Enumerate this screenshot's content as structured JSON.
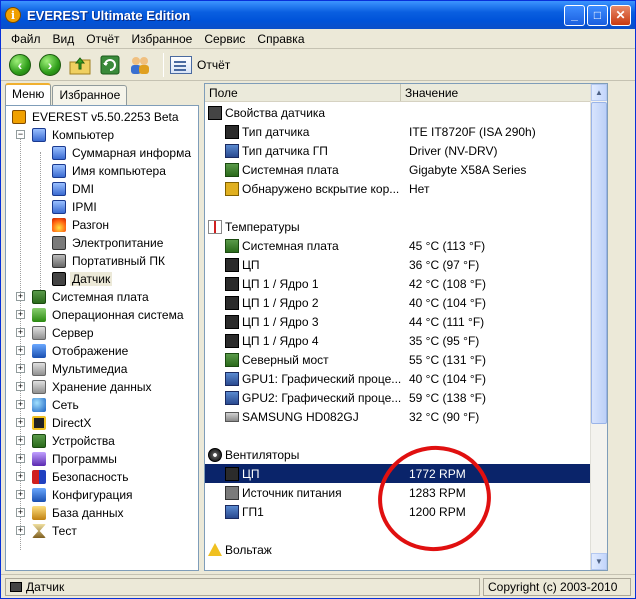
{
  "window": {
    "title": "EVEREST Ultimate Edition"
  },
  "menu": [
    "Файл",
    "Вид",
    "Отчёт",
    "Избранное",
    "Сервис",
    "Справка"
  ],
  "toolbar": {
    "report_label": "Отчёт"
  },
  "tabs": {
    "menu": "Меню",
    "favorites": "Избранное"
  },
  "tree": {
    "root": "EVEREST v5.50.2253 Beta",
    "computer": "Компьютер",
    "computer_children": [
      "Суммарная информа",
      "Имя компьютера",
      "DMI",
      "IPMI",
      "Разгон",
      "Электропитание",
      "Портативный ПК",
      "Датчик"
    ],
    "sections": [
      "Системная плата",
      "Операционная система",
      "Сервер",
      "Отображение",
      "Мультимедиа",
      "Хранение данных",
      "Сеть",
      "DirectX",
      "Устройства",
      "Программы",
      "Безопасность",
      "Конфигурация",
      "База данных",
      "Тест"
    ]
  },
  "columns": {
    "field": "Поле",
    "value": "Значение"
  },
  "groups": {
    "sensor_props": {
      "title": "Свойства датчика",
      "rows": [
        {
          "field": "Тип датчика",
          "value": "ITE IT8720F  (ISA 290h)"
        },
        {
          "field": "Тип датчика ГП",
          "value": "Driver  (NV-DRV)"
        },
        {
          "field": "Системная плата",
          "value": "Gigabyte X58A Series"
        },
        {
          "field": "Обнаружено вскрытие кор...",
          "value": "Нет"
        }
      ]
    },
    "temperatures": {
      "title": "Температуры",
      "rows": [
        {
          "field": "Системная плата",
          "value": "45 °C  (113 °F)"
        },
        {
          "field": "ЦП",
          "value": "36 °C  (97 °F)"
        },
        {
          "field": "ЦП 1 / Ядро 1",
          "value": "42 °C  (108 °F)"
        },
        {
          "field": "ЦП 1 / Ядро 2",
          "value": "40 °C  (104 °F)"
        },
        {
          "field": "ЦП 1 / Ядро 3",
          "value": "44 °C  (111 °F)"
        },
        {
          "field": "ЦП 1 / Ядро 4",
          "value": "35 °C  (95 °F)"
        },
        {
          "field": "Северный мост",
          "value": "55 °C  (131 °F)"
        },
        {
          "field": "GPU1: Графический проце...",
          "value": "40 °C  (104 °F)"
        },
        {
          "field": "GPU2: Графический проце...",
          "value": "59 °C  (138 °F)"
        },
        {
          "field": "SAMSUNG HD082GJ",
          "value": "32 °C  (90 °F)"
        }
      ]
    },
    "fans": {
      "title": "Вентиляторы",
      "rows": [
        {
          "field": "ЦП",
          "value": "1772 RPM"
        },
        {
          "field": "Источник питания",
          "value": "1283 RPM"
        },
        {
          "field": "ГП1",
          "value": "1200 RPM"
        }
      ]
    },
    "voltage": {
      "title": "Вольтаж"
    }
  },
  "status": {
    "left": "Датчик",
    "right": "Copyright (c) 2003-2010"
  }
}
